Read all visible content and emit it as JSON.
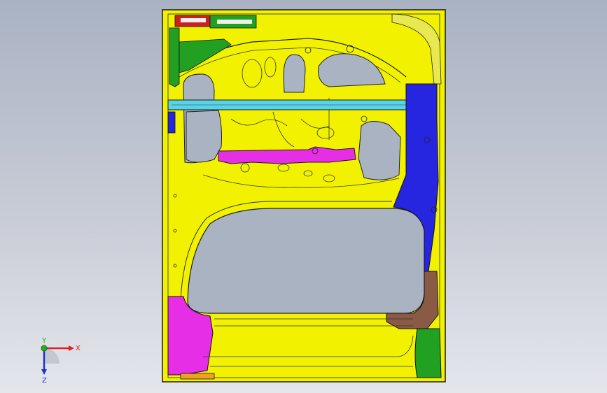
{
  "viewport": {
    "background_top": "#a9b2c3",
    "background_bottom": "#e4e6ec"
  },
  "model": {
    "colors": {
      "panel": "#f2f200",
      "outline": "#1a1a1a",
      "cutout": "#aab3c2",
      "beam": "#59d4e6",
      "reinforcement": "#e62ee6",
      "bracket_blue": "#2626e0",
      "brown": "#8a5a44",
      "green": "#22a022",
      "red": "#cc2020",
      "orange": "#f0a020"
    }
  },
  "triad": {
    "x_label": "X",
    "y_label": "Y",
    "z_label": "Z",
    "x_color": "#e02020",
    "y_color": "#20b020",
    "z_color": "#2030d0"
  }
}
